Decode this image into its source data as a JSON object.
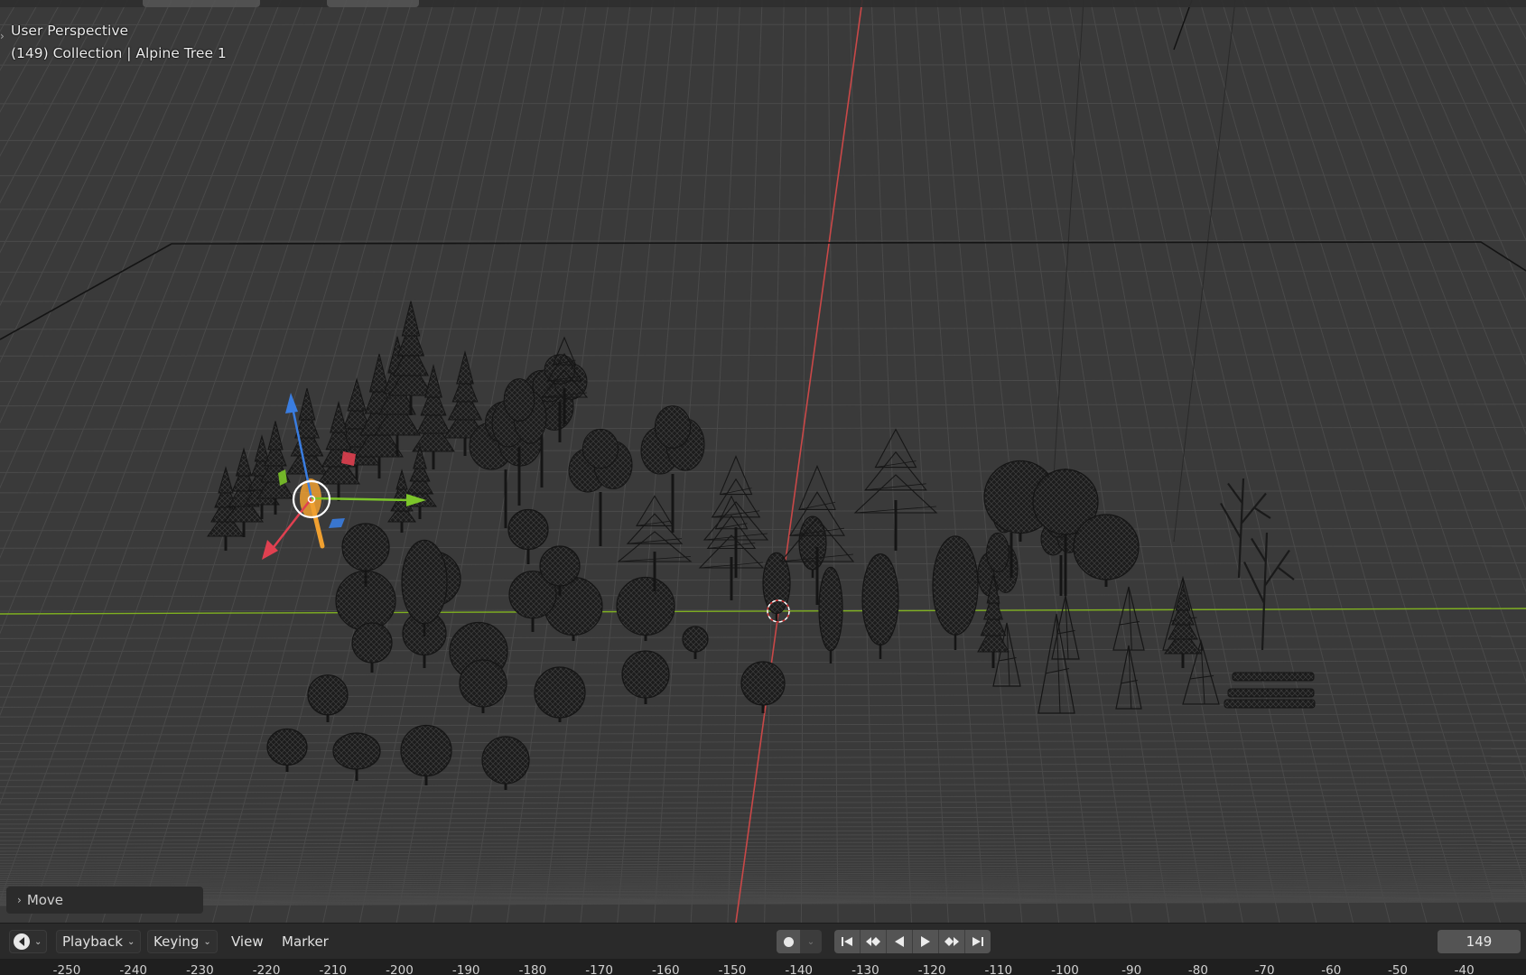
{
  "viewport": {
    "perspective_label": "User Perspective",
    "collection_label": "(149) Collection | Alpine Tree 1",
    "colors": {
      "background": "#3a3a3a",
      "grid": "#4a4a4a",
      "x_axis": "#c94848",
      "y_axis": "#7fb020",
      "selection": "#f0a030",
      "gizmo_z": "#3a7de0",
      "gizmo_x": "#e04050",
      "gizmo_y": "#7cc52a"
    }
  },
  "last_operator": {
    "label": "Move"
  },
  "timeline": {
    "editor_type_icon": "clock-icon",
    "menus": {
      "playback": "Playback",
      "keying": "Keying",
      "view": "View",
      "marker": "Marker"
    },
    "transport_icons": [
      "jump-start-icon",
      "prev-keyframe-icon",
      "play-reverse-icon",
      "play-icon",
      "next-keyframe-icon",
      "jump-end-icon"
    ],
    "current_frame": "149",
    "ruler_ticks": [
      "-250",
      "-240",
      "-230",
      "-220",
      "-210",
      "-200",
      "-190",
      "-180",
      "-170",
      "-160",
      "-150",
      "-140",
      "-130",
      "-120",
      "-110",
      "-100",
      "-90",
      "-80",
      "-70",
      "-60",
      "-50",
      "-40"
    ]
  }
}
